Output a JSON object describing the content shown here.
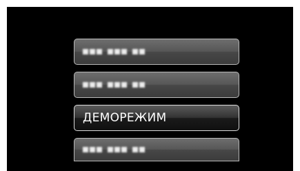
{
  "menu": {
    "items": [
      {
        "label": "",
        "state": "blurred-placeholder"
      },
      {
        "label": "",
        "state": "blurred-placeholder"
      },
      {
        "label": "ДЕМОРЕЖИМ",
        "state": "selected"
      },
      {
        "label": "",
        "state": "blurred-placeholder"
      }
    ]
  },
  "colors": {
    "screen_background": "#000000",
    "item_border": "#b9b9b9",
    "text": "#ffffff"
  }
}
